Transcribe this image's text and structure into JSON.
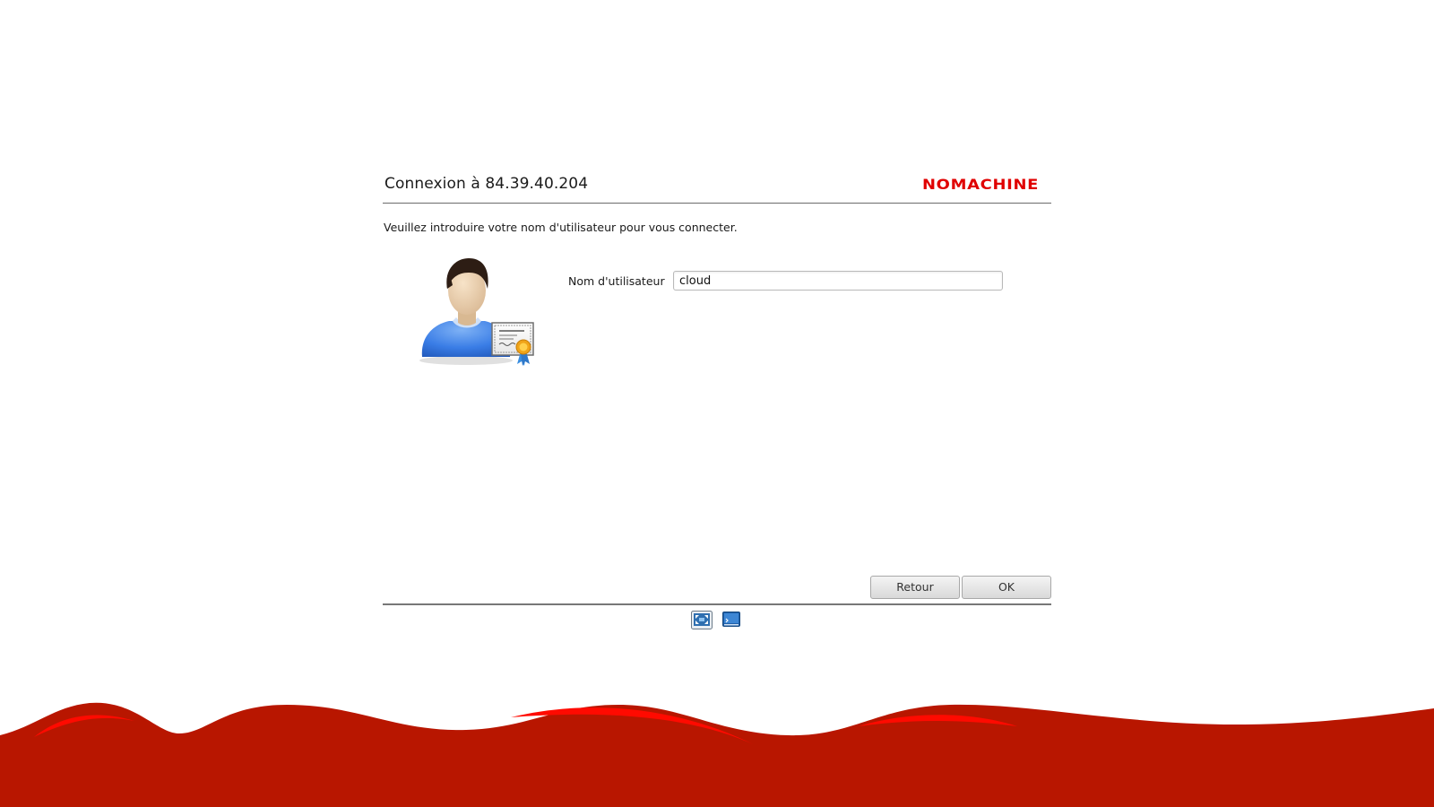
{
  "header": {
    "title": "Connexion à 84.39.40.204",
    "logo_text": "NOMACHINE"
  },
  "instruction": "Veuillez introduire votre nom d'utilisateur pour vous connecter.",
  "form": {
    "username_label": "Nom d'utilisateur",
    "username_value": "cloud"
  },
  "buttons": {
    "back_label": "Retour",
    "ok_label": "OK"
  },
  "icons": {
    "avatar": "user-certificate-icon",
    "display": "display-settings-icon",
    "terminal": "terminal-icon"
  },
  "colors": {
    "brand_red": "#e00000",
    "wave_red": "#b81600",
    "wave_highlight": "#ff0a00"
  }
}
